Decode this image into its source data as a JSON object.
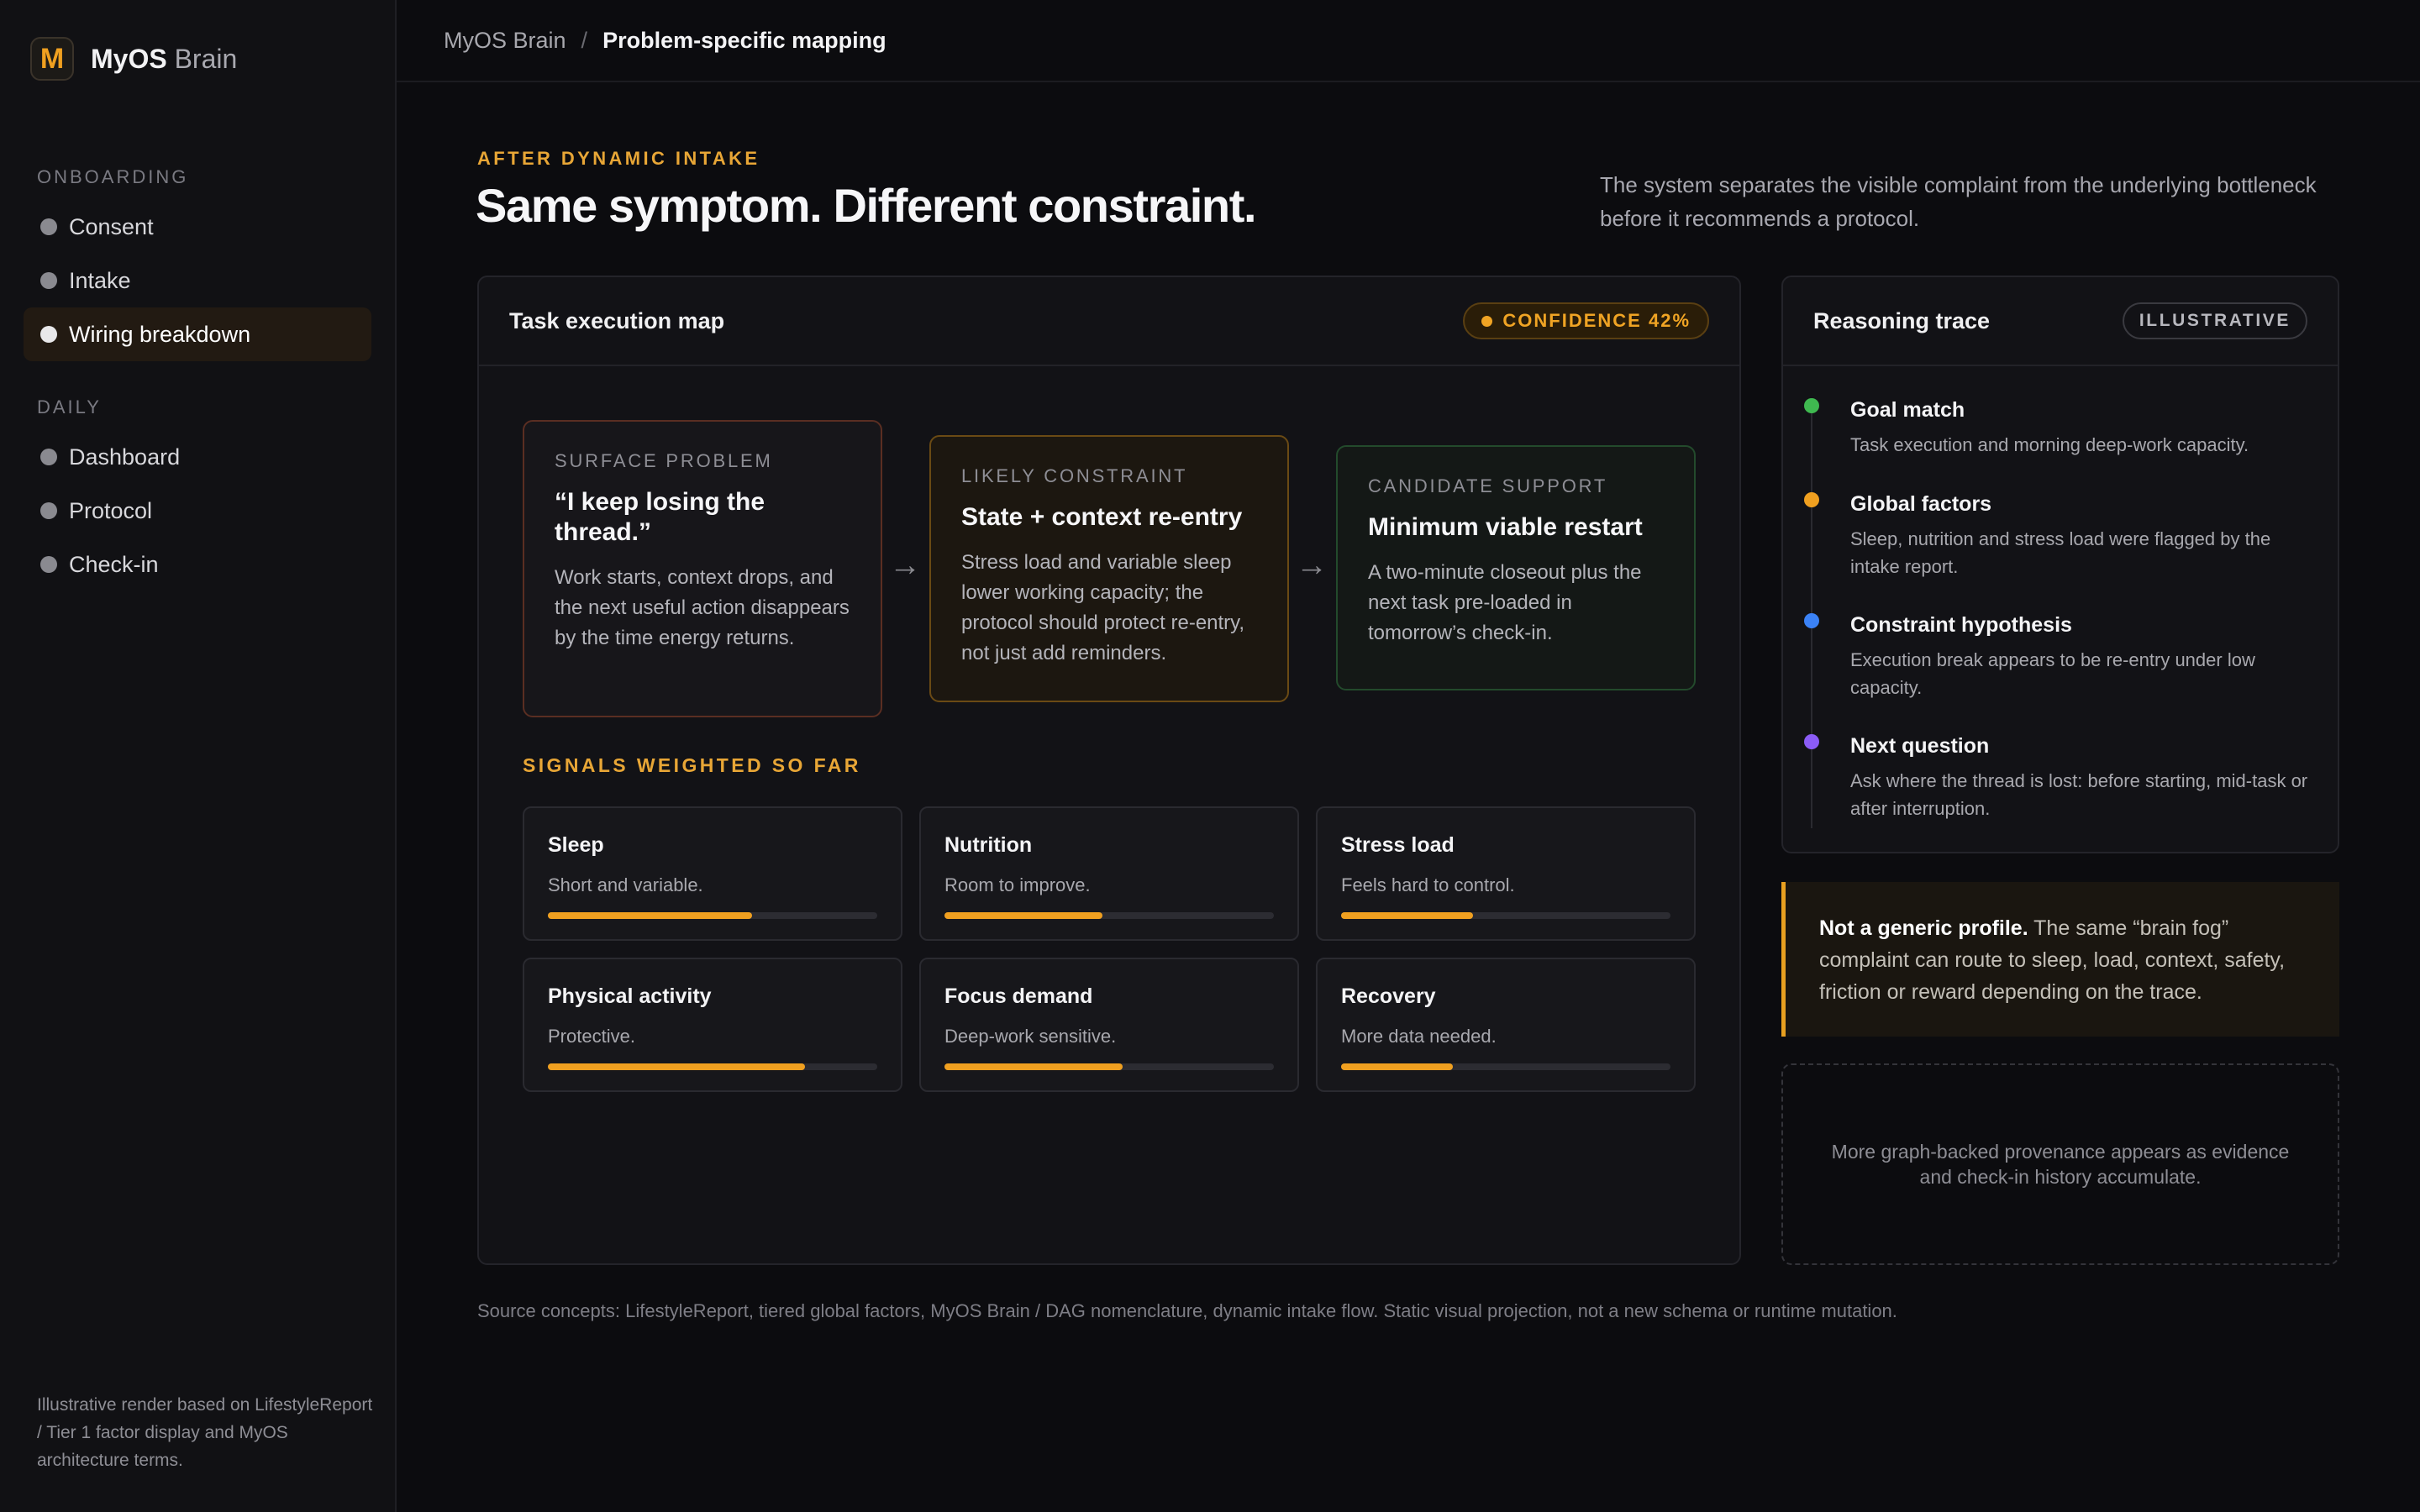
{
  "brand": {
    "mark": "M",
    "name": "MyOS",
    "name_sub": "Brain"
  },
  "sidebar": {
    "sections": [
      {
        "label": "ONBOARDING",
        "items": [
          {
            "label": "Consent"
          },
          {
            "label": "Intake"
          },
          {
            "label": "Wiring breakdown",
            "active": true
          }
        ]
      },
      {
        "label": "DAILY",
        "items": [
          {
            "label": "Dashboard"
          },
          {
            "label": "Protocol"
          },
          {
            "label": "Check-in"
          }
        ]
      }
    ],
    "footer": "Illustrative render based on LifestyleReport / Tier 1 factor display and MyOS architecture terms."
  },
  "breadcrumb": {
    "root": "MyOS Brain",
    "sep": "/",
    "current": "Problem-specific mapping"
  },
  "header": {
    "eyebrow": "AFTER DYNAMIC INTAKE",
    "title": "Same symptom. Different constraint.",
    "lede": "The system separates the visible complaint from the underlying bottleneck before it recommends a protocol."
  },
  "map": {
    "title": "Task execution map",
    "confidence": "CONFIDENCE 42%",
    "flow": [
      {
        "label": "SURFACE PROBLEM",
        "title": "“I keep losing the thread.”",
        "body": "Work starts, context drops, and the next useful action disappears by the time energy returns."
      },
      {
        "label": "LIKELY CONSTRAINT",
        "title": "State + context re-entry",
        "body": "Stress load and variable sleep lower working capacity; the protocol should protect re-entry, not just add reminders."
      },
      {
        "label": "CANDIDATE SUPPORT",
        "title": "Minimum viable restart",
        "body": "A two-minute closeout plus the next task pre-loaded in tomorrow’s check-in."
      }
    ],
    "arrow": "→",
    "signals_heading": "SIGNALS WEIGHTED SO FAR",
    "signals": [
      {
        "title": "Sleep",
        "desc": "Short and variable.",
        "level": 0.62
      },
      {
        "title": "Nutrition",
        "desc": "Room to improve.",
        "level": 0.48
      },
      {
        "title": "Stress load",
        "desc": "Feels hard to control.",
        "level": 0.4
      },
      {
        "title": "Physical activity",
        "desc": "Protective.",
        "level": 0.78
      },
      {
        "title": "Focus demand",
        "desc": "Deep-work sensitive.",
        "level": 0.54
      },
      {
        "title": "Recovery",
        "desc": "More data needed.",
        "level": 0.34
      }
    ]
  },
  "trace": {
    "title": "Reasoning trace",
    "badge": "ILLUSTRATIVE",
    "items": [
      {
        "title": "Goal match",
        "body": "Task execution and morning deep-work capacity.",
        "color": "#3fb950"
      },
      {
        "title": "Global factors",
        "body": "Sleep, nutrition and stress load were flagged by the intake report.",
        "color": "#f0a020"
      },
      {
        "title": "Constraint hypothesis",
        "body": "Execution break appears to be re-entry under low capacity.",
        "color": "#3b82f6"
      },
      {
        "title": "Next question",
        "body": "Ask where the thread is lost: before starting, mid-task or after interruption.",
        "color": "#8b5cf6"
      }
    ]
  },
  "callout": {
    "bold": "Not a generic profile.",
    "text": " The same “brain fog” complaint can route to sleep, load, context, safety, friction or reward depending on the trace."
  },
  "provenance": "More graph-backed provenance appears as evidence and check-in history accumulate.",
  "source": "Source concepts: LifestyleReport, tiered global factors, MyOS Brain / DAG nomenclature, dynamic intake flow. Static visual projection, not a new schema or runtime mutation."
}
